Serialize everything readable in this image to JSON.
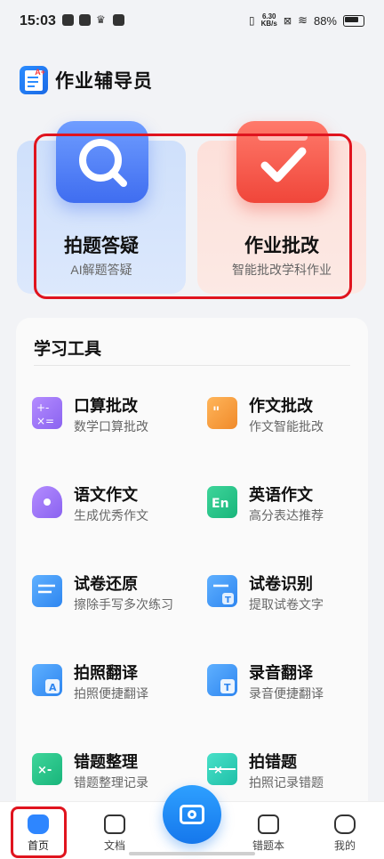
{
  "status_bar": {
    "time": "15:03",
    "speed_value": "6.30",
    "speed_unit": "KB/s",
    "battery": "88%"
  },
  "app": {
    "title": "作业辅导员"
  },
  "hero": [
    {
      "title": "拍题答疑",
      "subtitle": "AI解题答疑",
      "icon": "search-icon",
      "color": "#3f6df0"
    },
    {
      "title": "作业批改",
      "subtitle": "智能批改学科作业",
      "icon": "check-icon",
      "color": "#f0463a"
    }
  ],
  "tools": {
    "title": "学习工具",
    "items": [
      {
        "name": "口算批改",
        "desc": "数学口算批改",
        "icon": "math-icon"
      },
      {
        "name": "作文批改",
        "desc": "作文智能批改",
        "icon": "essay-icon"
      },
      {
        "name": "语文作文",
        "desc": "生成优秀作文",
        "icon": "pen-icon"
      },
      {
        "name": "英语作文",
        "desc": "高分表达推荐",
        "icon": "english-icon"
      },
      {
        "name": "试卷还原",
        "desc": "擦除手写多次练习",
        "icon": "paper-restore-icon"
      },
      {
        "name": "试卷识别",
        "desc": "提取试卷文字",
        "icon": "paper-scan-icon"
      },
      {
        "name": "拍照翻译",
        "desc": "拍照便捷翻译",
        "icon": "photo-translate-icon"
      },
      {
        "name": "录音翻译",
        "desc": "录音便捷翻译",
        "icon": "audio-translate-icon"
      },
      {
        "name": "错题整理",
        "desc": "错题整理记录",
        "icon": "wrong-organize-icon"
      },
      {
        "name": "拍错题",
        "desc": "拍照记录错题",
        "icon": "wrong-scan-icon"
      }
    ]
  },
  "tab_bar": {
    "home": "首页",
    "docs": "文档",
    "mistakes": "错题本",
    "mine": "我的"
  }
}
